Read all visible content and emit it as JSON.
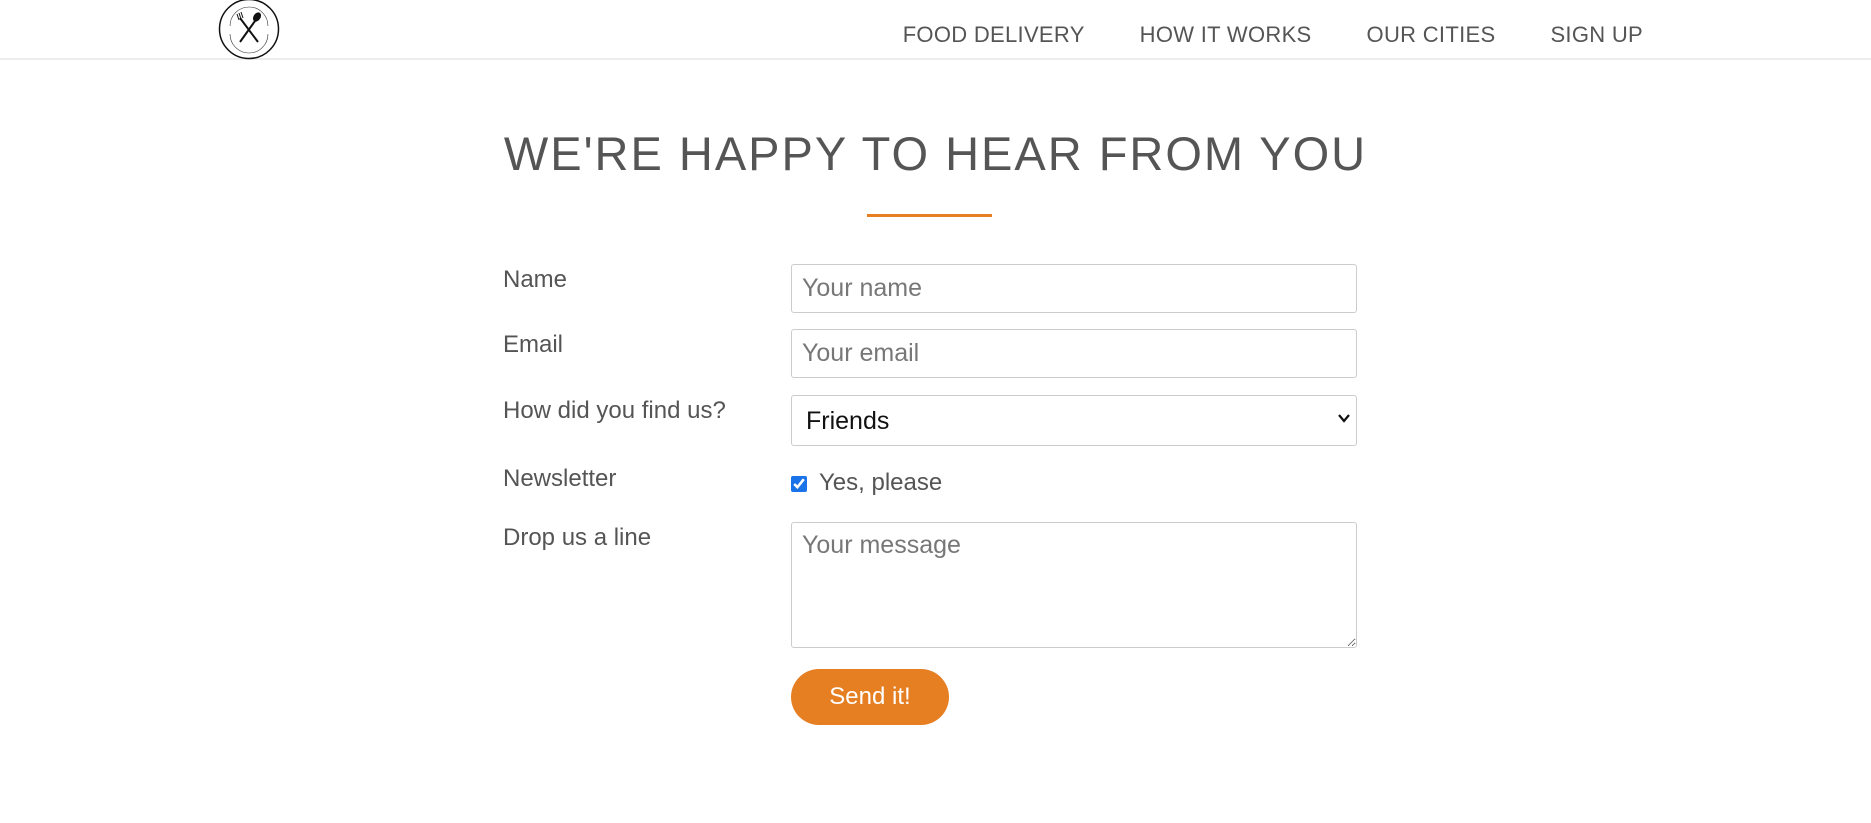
{
  "nav": {
    "logo_icon": "fork-knife-logo-icon",
    "items": [
      {
        "label": "FOOD DELIVERY"
      },
      {
        "label": "HOW IT WORKS"
      },
      {
        "label": "OUR CITIES"
      },
      {
        "label": "SIGN UP"
      }
    ]
  },
  "section": {
    "title": "WE'RE HAPPY TO HEAR FROM YOU"
  },
  "form": {
    "name": {
      "label": "Name",
      "placeholder": "Your name",
      "value": ""
    },
    "email": {
      "label": "Email",
      "placeholder": "Your email",
      "value": ""
    },
    "find_us": {
      "label": "How did you find us?",
      "selected": "Friends"
    },
    "newsletter": {
      "label": "Newsletter",
      "checkbox_label": "Yes, please",
      "checked": true
    },
    "message": {
      "label": "Drop us a line",
      "placeholder": "Your message",
      "value": ""
    },
    "submit_label": "Send it!"
  },
  "colors": {
    "accent": "#e67e22",
    "text": "#555555",
    "border": "#cccccc"
  }
}
